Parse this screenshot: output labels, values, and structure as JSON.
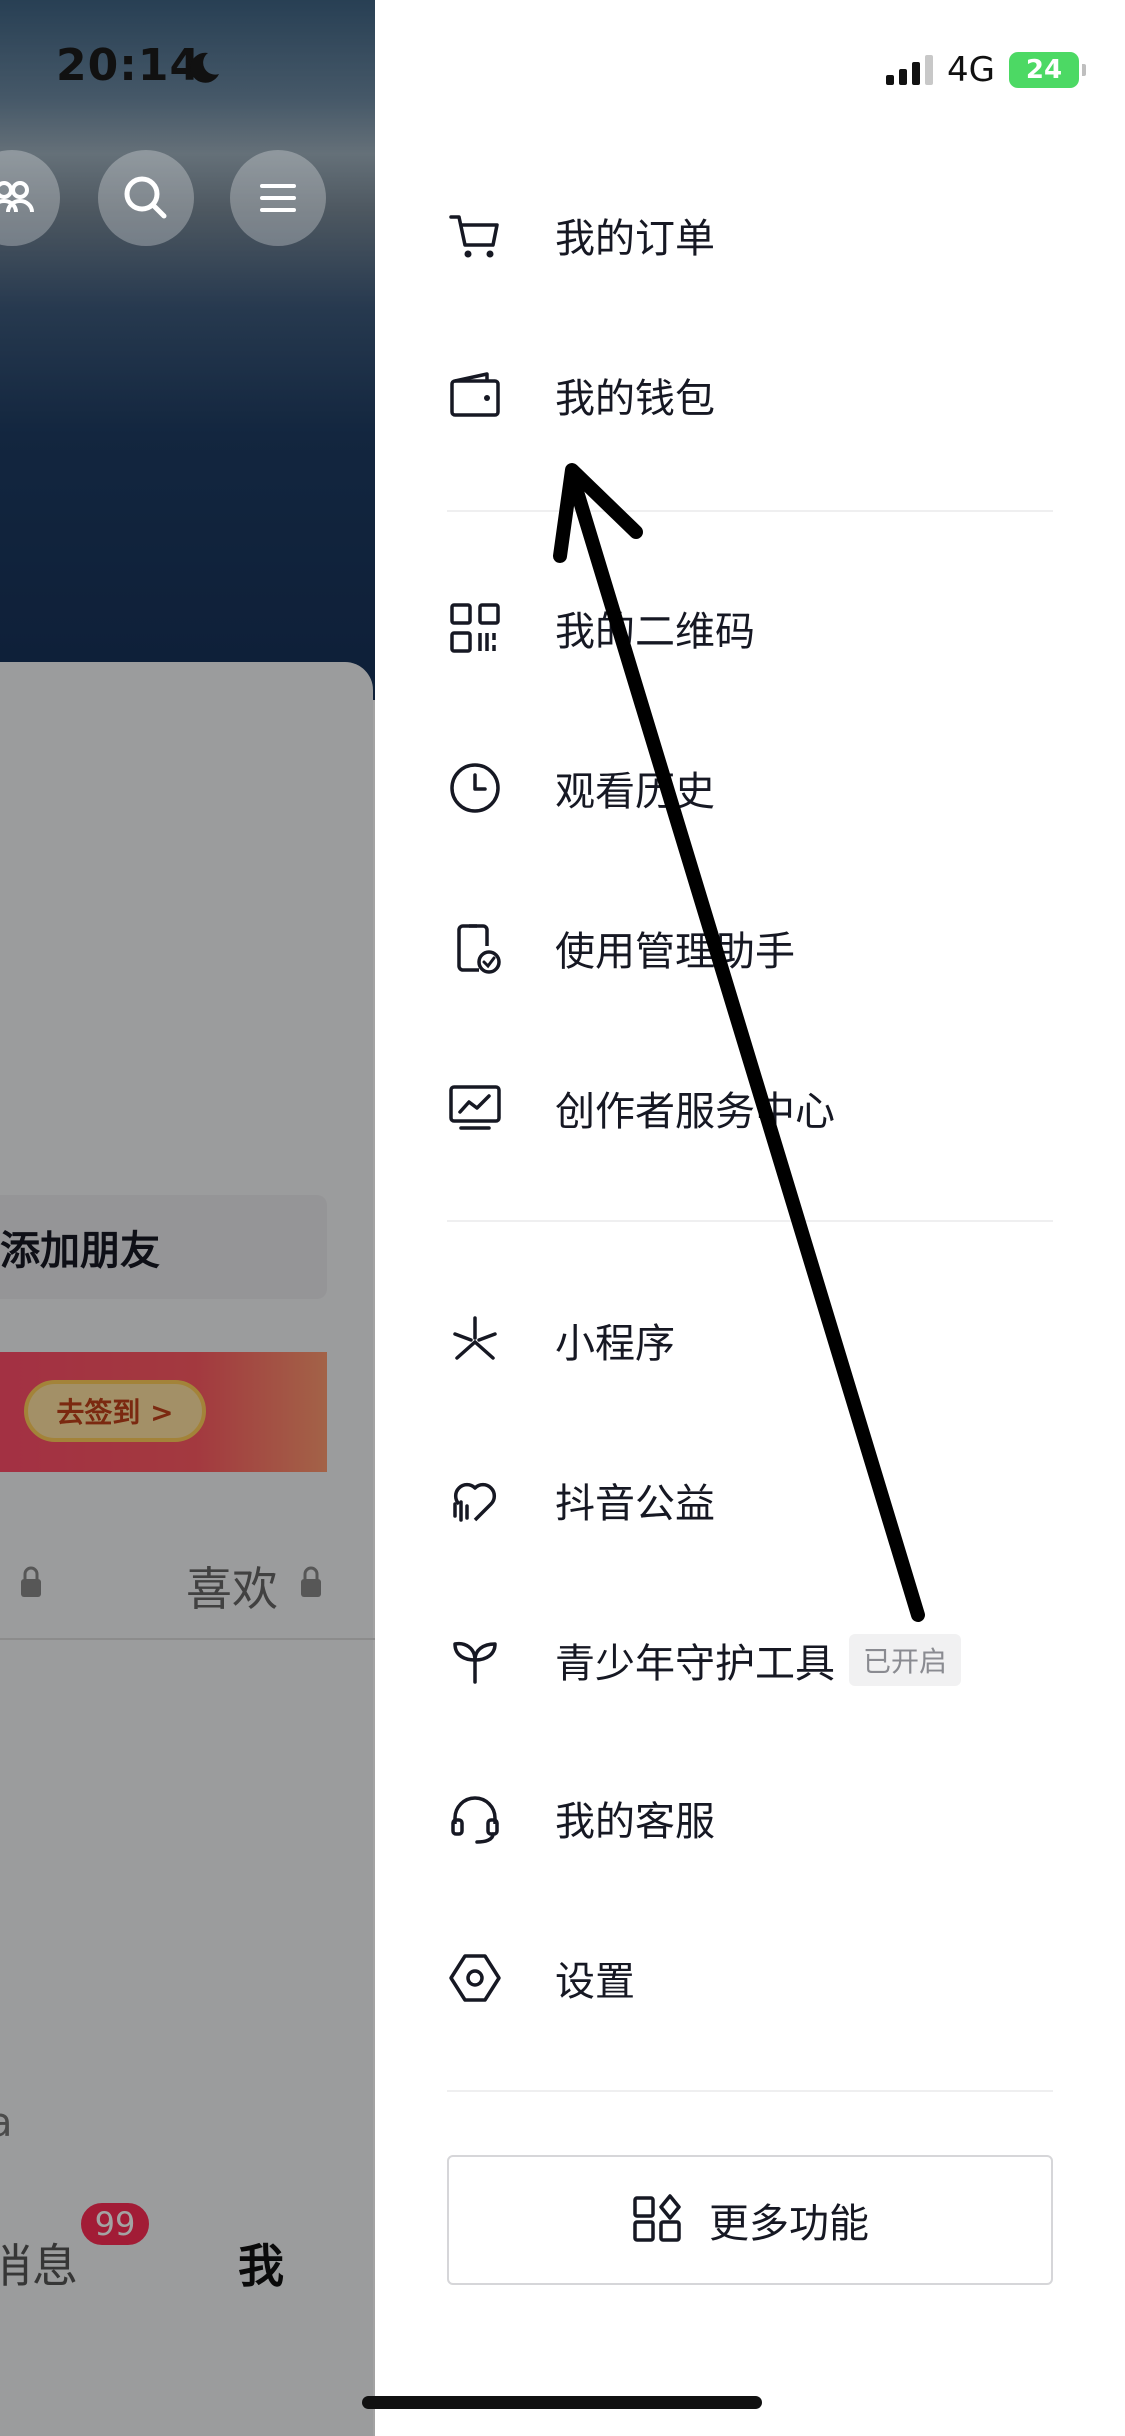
{
  "status_bar": {
    "time": "20:14",
    "network": "4G",
    "battery": "24"
  },
  "left_page": {
    "add_friend": "添加朋友",
    "sign_in_button": "去签到 >",
    "tab_likes": "喜欢",
    "nav_messages": "消息",
    "messages_badge": "99",
    "nav_me": "我",
    "fragment": "a"
  },
  "drawer": {
    "items": [
      {
        "label": "我的订单",
        "icon": "cart-icon"
      },
      {
        "label": "我的钱包",
        "icon": "wallet-icon"
      },
      {
        "label": "我的二维码",
        "icon": "qr-code-icon"
      },
      {
        "label": "观看历史",
        "icon": "clock-icon"
      },
      {
        "label": "使用管理助手",
        "icon": "phone-check-icon"
      },
      {
        "label": "创作者服务中心",
        "icon": "monitor-chart-icon"
      },
      {
        "label": "小程序",
        "icon": "mini-program-icon"
      },
      {
        "label": "抖音公益",
        "icon": "heart-charity-icon"
      },
      {
        "label": "青少年守护工具",
        "icon": "sprout-icon",
        "tag": "已开启"
      },
      {
        "label": "我的客服",
        "icon": "headset-icon"
      },
      {
        "label": "设置",
        "icon": "settings-hex-icon"
      }
    ],
    "more_button": "更多功能"
  },
  "colors": {
    "badge": "#fe2c55",
    "battery": "#4cd964",
    "text": "#161823"
  }
}
